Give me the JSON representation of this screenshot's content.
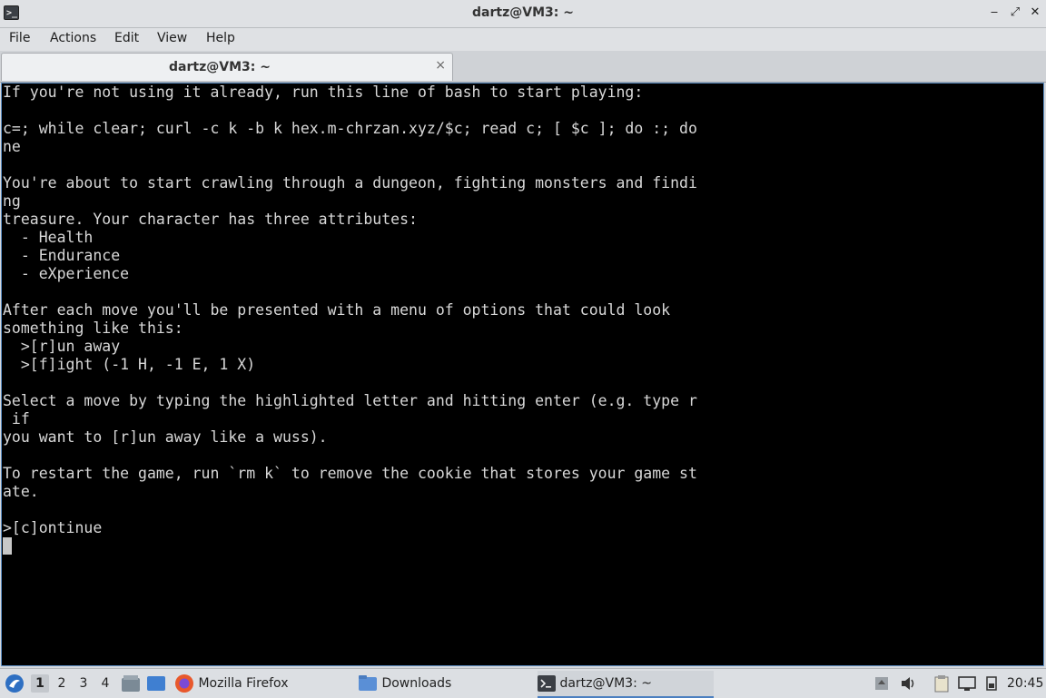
{
  "window": {
    "title": "dartz@VM3: ~"
  },
  "menu": [
    "File",
    "Actions",
    "Edit",
    "View",
    "Help"
  ],
  "tab": {
    "label": "dartz@VM3: ~",
    "close_glyph": "×"
  },
  "terminal": {
    "lines": [
      "If you're not using it already, run this line of bash to start playing:",
      "",
      "c=; while clear; curl -c k -b k hex.m-chrzan.xyz/$c; read c; [ $c ]; do :; do",
      "ne",
      "",
      "You're about to start crawling through a dungeon, fighting monsters and findi",
      "ng",
      "treasure. Your character has three attributes:",
      "  - Health",
      "  - Endurance",
      "  - eXperience",
      "",
      "After each move you'll be presented with a menu of options that could look",
      "something like this:",
      "  >[r]un away",
      "  >[f]ight (-1 H, -1 E, 1 X)",
      "",
      "Select a move by typing the highlighted letter and hitting enter (e.g. type r",
      " if",
      "you want to [r]un away like a wuss).",
      "",
      "To restart the game, run `rm k` to remove the cookie that stores your game st",
      "ate.",
      "",
      ">[c]ontinue"
    ]
  },
  "taskbar": {
    "workspaces": [
      "1",
      "2",
      "3",
      "4"
    ],
    "tasks": {
      "firefox": "Mozilla Firefox",
      "downloads": "Downloads",
      "terminal": "dartz@VM3: ~"
    },
    "clock": "20:45"
  },
  "colors": {
    "terminal_bg": "#000000",
    "terminal_fg": "#d8d8d8",
    "accent": "#4b7fc0"
  }
}
